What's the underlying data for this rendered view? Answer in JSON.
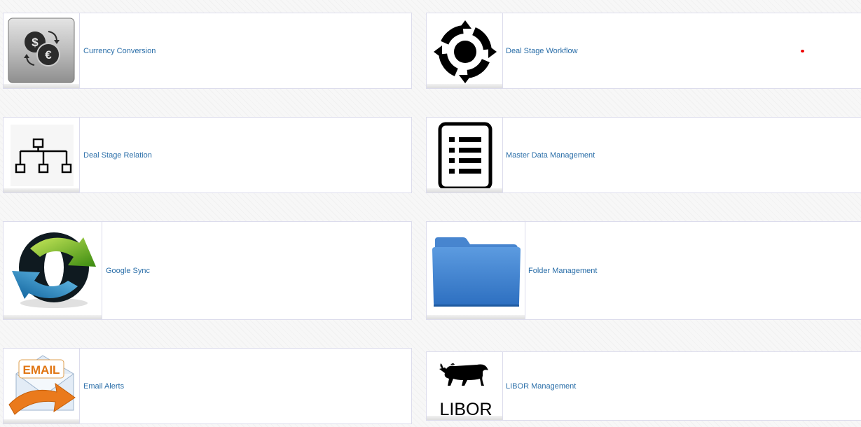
{
  "tiles": [
    {
      "label": "Currency Conversion",
      "icon": "currency-conversion-icon"
    },
    {
      "label": "Deal Stage Workflow",
      "icon": "workflow-cycle-icon"
    },
    {
      "label": "Deal Stage Relation",
      "icon": "hierarchy-icon"
    },
    {
      "label": "Master Data Management",
      "icon": "list-document-icon"
    },
    {
      "label": "Google Sync",
      "icon": "sync-arrows-icon"
    },
    {
      "label": "Folder Management",
      "icon": "folder-icon"
    },
    {
      "label": "Email Alerts",
      "icon": "email-envelope-icon"
    },
    {
      "label": "LIBOR Management",
      "icon": "libor-bull-logo-icon",
      "logo_text": "LIBOR"
    }
  ],
  "colors": {
    "link": "#2a6ea8",
    "border": "#dcdcec"
  }
}
